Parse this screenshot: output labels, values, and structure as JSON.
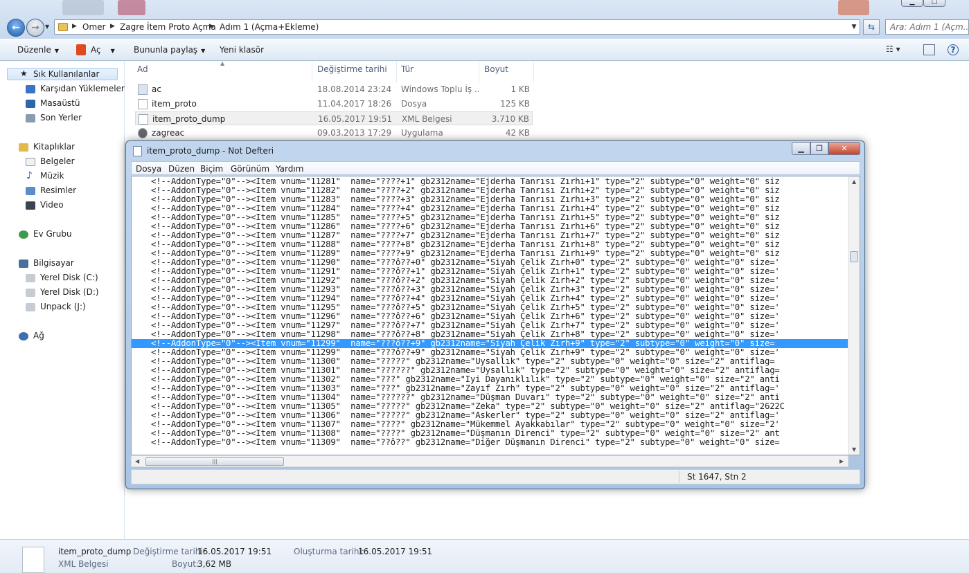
{
  "explorer": {
    "breadcrumbs": [
      "Omer",
      "Zagre İtem Proto Açma",
      "Adım 1 (Açma+Ekleme)"
    ],
    "search_placeholder": "Ara: Adım 1 (Açm...",
    "toolbar": {
      "organize": "Düzenle",
      "open": "Aç",
      "share": "Bununla paylaş",
      "new_folder": "Yeni klasör"
    },
    "nav": {
      "favorites": "Sık Kullanılanlar",
      "downloads": "Karşıdan Yüklemeler",
      "desktop": "Masaüstü",
      "recent": "Son Yerler",
      "libraries": "Kitaplıklar",
      "documents": "Belgeler",
      "music": "Müzik",
      "pictures": "Resimler",
      "video": "Video",
      "homegroup": "Ev Grubu",
      "computer": "Bilgisayar",
      "drive_c": "Yerel Disk (C:)",
      "drive_d": "Yerel Disk (D:)",
      "drive_j": "Unpack (J:)",
      "network": "Ağ"
    },
    "columns": {
      "name": "Ad",
      "modified": "Değiştirme tarihi",
      "type": "Tür",
      "size": "Boyut"
    },
    "files": [
      {
        "name": "ac",
        "modified": "18.08.2014 23:24",
        "type": "Windows Toplu İş ...",
        "size": "1 KB"
      },
      {
        "name": "item_proto",
        "modified": "11.04.2017 18:26",
        "type": "Dosya",
        "size": "125 KB"
      },
      {
        "name": "item_proto_dump",
        "modified": "16.05.2017 19:51",
        "type": "XML Belgesi",
        "size": "3.710 KB"
      },
      {
        "name": "zagreac",
        "modified": "09.03.2013 17:29",
        "type": "Uygulama",
        "size": "42 KB"
      }
    ],
    "details": {
      "name": "item_proto_dump",
      "type": "XML Belgesi",
      "modified_label": "Değiştirme tarihi:",
      "modified": "16.05.2017 19:51",
      "size_label": "Boyut:",
      "size": "3,62 MB",
      "created_label": "Oluşturma tarihi:",
      "created": "16.05.2017 19:51"
    }
  },
  "notepad": {
    "title": "item_proto_dump - Not Defteri",
    "menu": [
      "Dosya",
      "Düzen",
      "Biçim",
      "Görünüm",
      "Yardım"
    ],
    "status": "St 1647, Stn 2",
    "selected_line": 18,
    "lines": [
      "<!--AddonType=\"0\"--><Item vnum=\"11281\"  name=\"????+1\" gb2312name=\"Ejderha Tanrısı Zırhı+1\" type=\"2\" subtype=\"0\" weight=\"0\" siz",
      "<!--AddonType=\"0\"--><Item vnum=\"11282\"  name=\"????+2\" gb2312name=\"Ejderha Tanrısı Zırhı+2\" type=\"2\" subtype=\"0\" weight=\"0\" siz",
      "<!--AddonType=\"0\"--><Item vnum=\"11283\"  name=\"????+3\" gb2312name=\"Ejderha Tanrısı Zırhı+3\" type=\"2\" subtype=\"0\" weight=\"0\" siz",
      "<!--AddonType=\"0\"--><Item vnum=\"11284\"  name=\"????+4\" gb2312name=\"Ejderha Tanrısı Zırhı+4\" type=\"2\" subtype=\"0\" weight=\"0\" siz",
      "<!--AddonType=\"0\"--><Item vnum=\"11285\"  name=\"????+5\" gb2312name=\"Ejderha Tanrısı Zırhı+5\" type=\"2\" subtype=\"0\" weight=\"0\" siz",
      "<!--AddonType=\"0\"--><Item vnum=\"11286\"  name=\"????+6\" gb2312name=\"Ejderha Tanrısı Zırhı+6\" type=\"2\" subtype=\"0\" weight=\"0\" siz",
      "<!--AddonType=\"0\"--><Item vnum=\"11287\"  name=\"????+7\" gb2312name=\"Ejderha Tanrısı Zırhı+7\" type=\"2\" subtype=\"0\" weight=\"0\" siz",
      "<!--AddonType=\"0\"--><Item vnum=\"11288\"  name=\"????+8\" gb2312name=\"Ejderha Tanrısı Zırhı+8\" type=\"2\" subtype=\"0\" weight=\"0\" siz",
      "<!--AddonType=\"0\"--><Item vnum=\"11289\"  name=\"????+9\" gb2312name=\"Ejderha Tanrısı Zırhı+9\" type=\"2\" subtype=\"0\" weight=\"0\" siz",
      "<!--AddonType=\"0\"--><Item vnum=\"11290\"  name=\"???ô??+0\" gb2312name=\"Siyah Çelik Zırh+0\" type=\"2\" subtype=\"0\" weight=\"0\" size='",
      "<!--AddonType=\"0\"--><Item vnum=\"11291\"  name=\"???ô??+1\" gb2312name=\"Siyah Çelik Zırh+1\" type=\"2\" subtype=\"0\" weight=\"0\" size='",
      "<!--AddonType=\"0\"--><Item vnum=\"11292\"  name=\"???ô??+2\" gb2312name=\"Siyah Çelik Zırh+2\" type=\"2\" subtype=\"0\" weight=\"0\" size='",
      "<!--AddonType=\"0\"--><Item vnum=\"11293\"  name=\"???ô??+3\" gb2312name=\"Siyah Çelik Zırh+3\" type=\"2\" subtype=\"0\" weight=\"0\" size='",
      "<!--AddonType=\"0\"--><Item vnum=\"11294\"  name=\"???ô??+4\" gb2312name=\"Siyah Çelik Zırh+4\" type=\"2\" subtype=\"0\" weight=\"0\" size='",
      "<!--AddonType=\"0\"--><Item vnum=\"11295\"  name=\"???ô??+5\" gb2312name=\"Siyah Çelik Zırh+5\" type=\"2\" subtype=\"0\" weight=\"0\" size='",
      "<!--AddonType=\"0\"--><Item vnum=\"11296\"  name=\"???ô??+6\" gb2312name=\"Siyah Çelik Zırh+6\" type=\"2\" subtype=\"0\" weight=\"0\" size='",
      "<!--AddonType=\"0\"--><Item vnum=\"11297\"  name=\"???ô??+7\" gb2312name=\"Siyah Çelik Zırh+7\" type=\"2\" subtype=\"0\" weight=\"0\" size='",
      "<!--AddonType=\"0\"--><Item vnum=\"11298\"  name=\"???ô??+8\" gb2312name=\"Siyah Çelik Zırh+8\" type=\"2\" subtype=\"0\" weight=\"0\" size='",
      "<!--AddonType=\"0\"--><Item vnum=\"11299\"  name=\"???ô??+9\" gb2312name=\"Siyah Çelik Zırh+9\" type=\"2\" subtype=\"0\" weight=\"0\" size=",
      "<!--AddonType=\"0\"--><Item vnum=\"11299\"  name=\"???ô??+9\" gb2312name=\"Siyah Çelik Zırh+9\" type=\"2\" subtype=\"0\" weight=\"0\" size='",
      "<!--AddonType=\"0\"--><Item vnum=\"11300\"  name=\"?????\" gb2312name=\"Uysallık\" type=\"2\" subtype=\"0\" weight=\"0\" size=\"2\" antiflag=",
      "<!--AddonType=\"0\"--><Item vnum=\"11301\"  name=\"??????\" gb2312name=\"Uysallık\" type=\"2\" subtype=\"0\" weight=\"0\" size=\"2\" antiflag=",
      "<!--AddonType=\"0\"--><Item vnum=\"11302\"  name=\"???\" gb2312name=\"İyi Dayanıklılık\" type=\"2\" subtype=\"0\" weight=\"0\" size=\"2\" anti",
      "<!--AddonType=\"0\"--><Item vnum=\"11303\"  name=\"???\" gb2312name=\"Zayıf Zırh\" type=\"2\" subtype=\"0\" weight=\"0\" size=\"2\" antiflag='",
      "<!--AddonType=\"0\"--><Item vnum=\"11304\"  name=\"??????\" gb2312name=\"Düşman Duvarı\" type=\"2\" subtype=\"0\" weight=\"0\" size=\"2\" anti",
      "<!--AddonType=\"0\"--><Item vnum=\"11305\"  name=\"?????\" gb2312name=\"Zeka\" type=\"2\" subtype=\"0\" weight=\"0\" size=\"2\" antiflag=\"2622C",
      "<!--AddonType=\"0\"--><Item vnum=\"11306\"  name=\"?????\" gb2312name=\"Askerler\" type=\"2\" subtype=\"0\" weight=\"0\" size=\"2\" antiflag='",
      "<!--AddonType=\"0\"--><Item vnum=\"11307\"  name=\"????\" gb2312name=\"Mükemmel Ayakkabılar\" type=\"2\" subtype=\"0\" weight=\"0\" size=\"2'",
      "<!--AddonType=\"0\"--><Item vnum=\"11308\"  name=\"????\" gb2312name=\"Düşmanın Direnci\" type=\"2\" subtype=\"0\" weight=\"0\" size=\"2\" ant",
      "<!--AddonType=\"0\"--><Item vnum=\"11309\"  name=\"??ô??\" gb2312name=\"Diğer Düşmanın Direnci\" type=\"2\" subtype=\"0\" weight=\"0\" size="
    ]
  }
}
